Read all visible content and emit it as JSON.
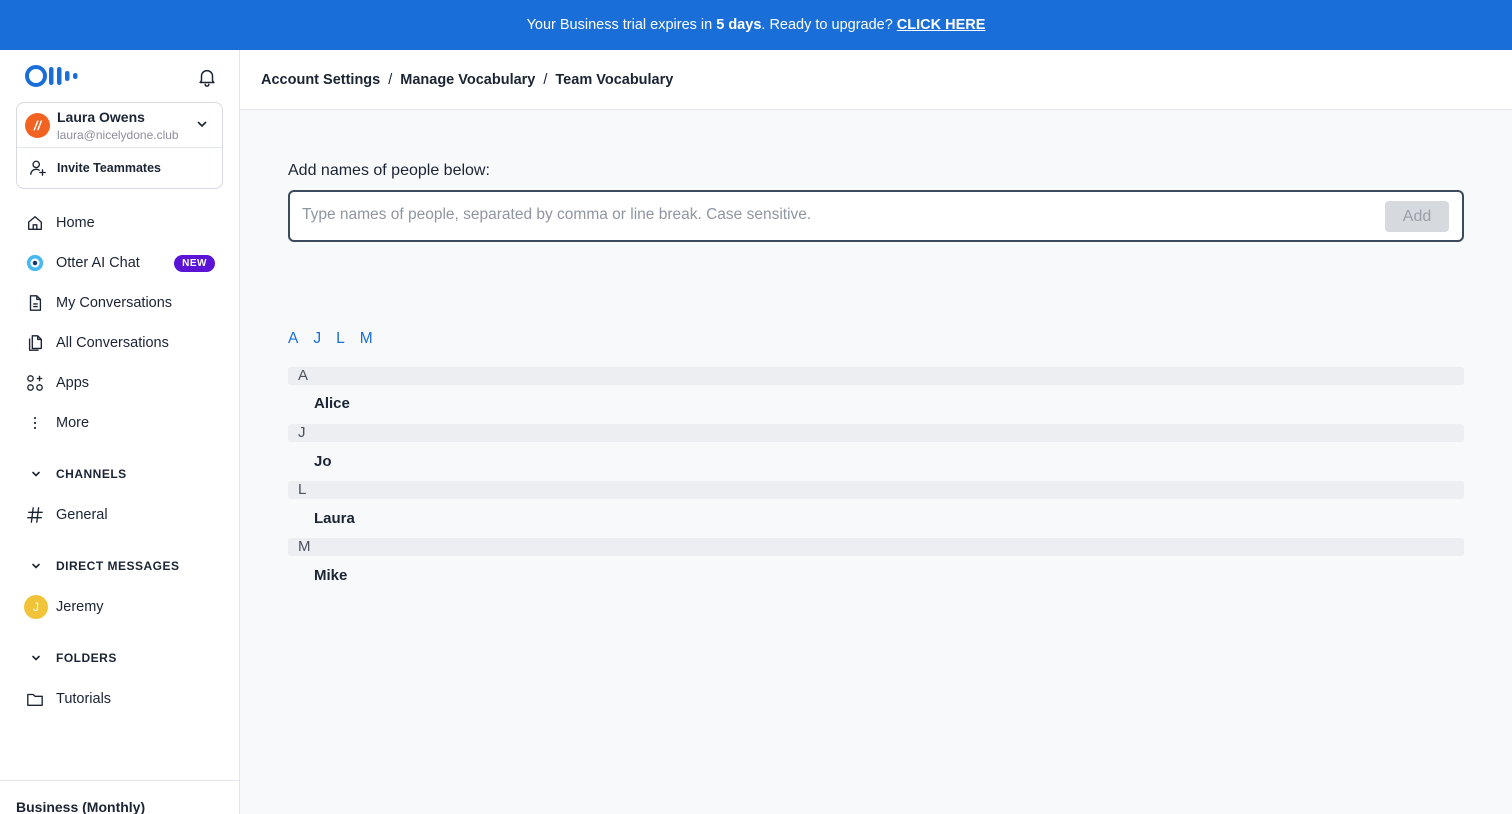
{
  "banner": {
    "text_pre": "Your Business trial expires in",
    "days": "5 days",
    "text_post": ". Ready to upgrade?",
    "cta": "CLICK HERE"
  },
  "sidebar": {
    "account": {
      "initial": "//",
      "name": "Laura Owens",
      "email": "laura@nicelydone.club"
    },
    "invite_label": "Invite Teammates",
    "nav": [
      {
        "label": "Home",
        "icon": "home-icon"
      },
      {
        "label": "Otter AI Chat",
        "icon": "otter-chat-icon",
        "badge": "NEW"
      },
      {
        "label": "My Conversations",
        "icon": "document-icon"
      },
      {
        "label": "All Conversations",
        "icon": "documents-icon"
      },
      {
        "label": "Apps",
        "icon": "apps-icon"
      },
      {
        "label": "More",
        "icon": "more-vertical-icon"
      }
    ],
    "channels": {
      "title": "CHANNELS",
      "items": [
        {
          "label": "General"
        }
      ]
    },
    "direct_messages": {
      "title": "DIRECT MESSAGES",
      "items": [
        {
          "label": "Jeremy",
          "initial": "J"
        }
      ]
    },
    "folders": {
      "title": "FOLDERS",
      "items": [
        {
          "label": "Tutorials"
        }
      ]
    },
    "plan": "Business (Monthly)"
  },
  "breadcrumb": [
    "Account Settings",
    "Manage Vocabulary",
    "Team Vocabulary"
  ],
  "add_section": {
    "label": "Add names of people below:",
    "placeholder": "Type names of people, separated by comma or line break. Case sensitive.",
    "value": "",
    "button": "Add"
  },
  "letter_index": [
    "A",
    "J",
    "L",
    "M"
  ],
  "groups": [
    {
      "letter": "A",
      "names": [
        "Alice"
      ]
    },
    {
      "letter": "J",
      "names": [
        "Jo"
      ]
    },
    {
      "letter": "L",
      "names": [
        "Laura"
      ]
    },
    {
      "letter": "M",
      "names": [
        "Mike"
      ]
    }
  ],
  "colors": {
    "brand": "#1a6ed8",
    "badge": "#5b13d6",
    "avatar_account": "#f26322",
    "avatar_dm": "#f0c338"
  }
}
